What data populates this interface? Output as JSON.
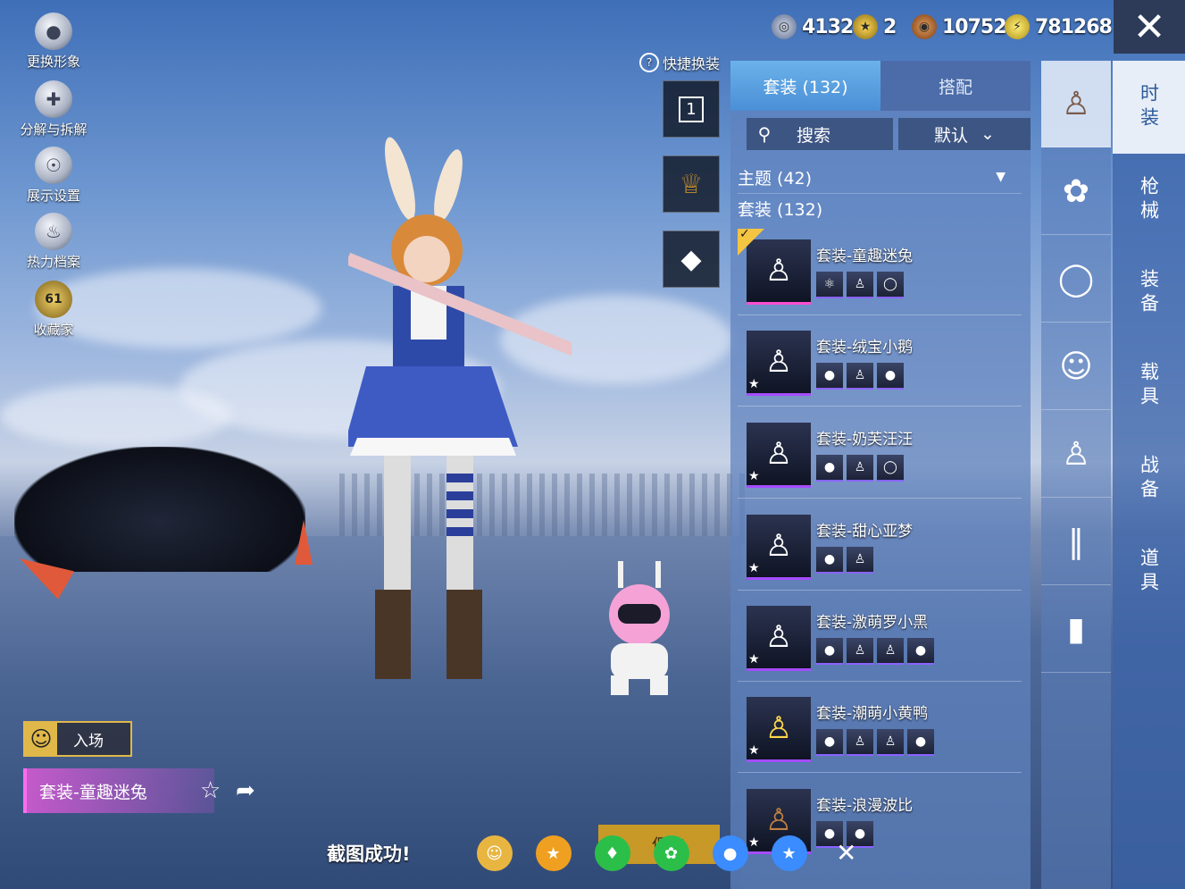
{
  "left_menu": [
    {
      "label": "更换形象",
      "icon": "avatar-icon"
    },
    {
      "label": "分解与拆解",
      "icon": "puzzle-icon"
    },
    {
      "label": "展示设置",
      "icon": "eye-icon"
    },
    {
      "label": "热力档案",
      "icon": "flame-icon"
    },
    {
      "label": "收藏家",
      "icon": "collector-badge-icon",
      "badge": "61"
    }
  ],
  "currencies": [
    {
      "icon": "uc-coin-icon",
      "value": "4132"
    },
    {
      "icon": "medal-icon",
      "value": "2"
    },
    {
      "icon": "bp-coin-icon",
      "value": "10752"
    },
    {
      "icon": "ag-coin-icon",
      "value": "781268"
    }
  ],
  "quick_change_label": "快捷换装",
  "outfit_slot_number": "1",
  "tabs": {
    "suits": "套装 (132)",
    "match": "搭配"
  },
  "search": {
    "label": "搜索",
    "sort": "默认"
  },
  "theme_filter": "主题 (42)",
  "suit_header": "套装 (132)",
  "entries": [
    {
      "name": "套装-童趣迷兔",
      "selected": true,
      "parts": 3,
      "thumb_color": "pink"
    },
    {
      "name": "套装-绒宝小鹅",
      "selected": false,
      "parts": 3,
      "thumb_color": "purple"
    },
    {
      "name": "套装-奶芙汪汪",
      "selected": false,
      "parts": 3,
      "thumb_color": "purple"
    },
    {
      "name": "套装-甜心亚梦",
      "selected": false,
      "parts": 2,
      "thumb_color": "purple"
    },
    {
      "name": "套装-激萌罗小黑",
      "selected": false,
      "parts": 4,
      "thumb_color": "purple"
    },
    {
      "name": "套装-潮萌小黄鸭",
      "selected": false,
      "parts": 4,
      "thumb_color": "purple"
    },
    {
      "name": "套装-浪漫波比",
      "selected": false,
      "parts": 2,
      "thumb_color": "purple"
    }
  ],
  "vertical_tabs": [
    "时装",
    "枪械",
    "装备",
    "载具",
    "战备",
    "道具"
  ],
  "active_vertical_tab": 0,
  "enter_label": "入场",
  "current_outfit": "套装-童趣迷兔",
  "screenshot_message": "截图成功!",
  "save_button_label": "保存",
  "colors": {
    "accent": "#4a8fd6",
    "rarity_purple": "#a64cff",
    "rarity_pink": "#ff4fd1",
    "gold": "#e0b84a"
  }
}
